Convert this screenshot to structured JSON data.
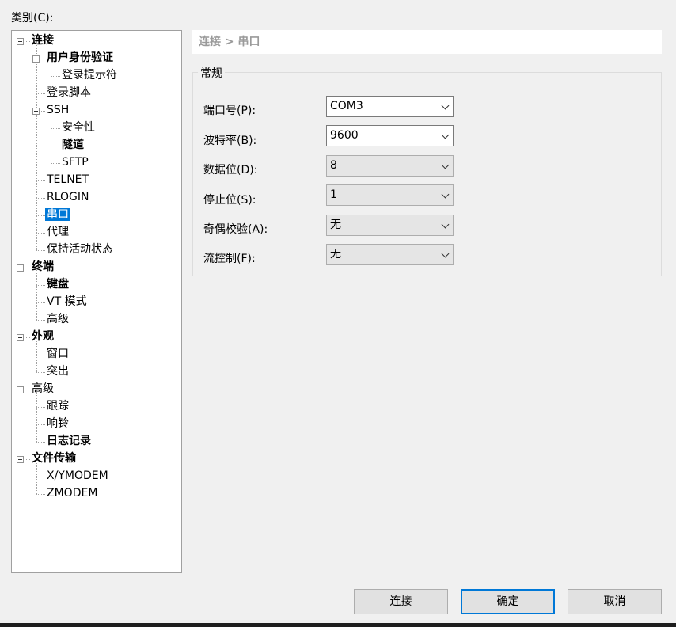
{
  "category_label": "类别(C):",
  "tree": [
    {
      "label": "连接",
      "level": 0,
      "bold": true,
      "toggle": true
    },
    {
      "label": "用户身份验证",
      "level": 1,
      "bold": true,
      "toggle": true
    },
    {
      "label": "登录提示符",
      "level": 2,
      "bold": false,
      "toggle": false
    },
    {
      "label": "登录脚本",
      "level": 1,
      "bold": false,
      "toggle": false
    },
    {
      "label": "SSH",
      "level": 1,
      "bold": false,
      "toggle": true
    },
    {
      "label": "安全性",
      "level": 2,
      "bold": false,
      "toggle": false
    },
    {
      "label": "隧道",
      "level": 2,
      "bold": true,
      "toggle": false
    },
    {
      "label": "SFTP",
      "level": 2,
      "bold": false,
      "toggle": false
    },
    {
      "label": "TELNET",
      "level": 1,
      "bold": false,
      "toggle": false
    },
    {
      "label": "RLOGIN",
      "level": 1,
      "bold": false,
      "toggle": false
    },
    {
      "label": "串口",
      "level": 1,
      "bold": false,
      "toggle": false,
      "selected": true
    },
    {
      "label": "代理",
      "level": 1,
      "bold": false,
      "toggle": false
    },
    {
      "label": "保持活动状态",
      "level": 1,
      "bold": false,
      "toggle": false
    },
    {
      "label": "终端",
      "level": 0,
      "bold": true,
      "toggle": true
    },
    {
      "label": "键盘",
      "level": 1,
      "bold": true,
      "toggle": false
    },
    {
      "label": "VT 模式",
      "level": 1,
      "bold": false,
      "toggle": false
    },
    {
      "label": "高级",
      "level": 1,
      "bold": false,
      "toggle": false
    },
    {
      "label": "外观",
      "level": 0,
      "bold": true,
      "toggle": true
    },
    {
      "label": "窗口",
      "level": 1,
      "bold": false,
      "toggle": false
    },
    {
      "label": "突出",
      "level": 1,
      "bold": false,
      "toggle": false
    },
    {
      "label": "高级",
      "level": 0,
      "bold": false,
      "toggle": true
    },
    {
      "label": "跟踪",
      "level": 1,
      "bold": false,
      "toggle": false
    },
    {
      "label": "响铃",
      "level": 1,
      "bold": false,
      "toggle": false
    },
    {
      "label": "日志记录",
      "level": 1,
      "bold": true,
      "toggle": false
    },
    {
      "label": "文件传输",
      "level": 0,
      "bold": true,
      "toggle": true
    },
    {
      "label": "X/YMODEM",
      "level": 1,
      "bold": false,
      "toggle": false
    },
    {
      "label": "ZMODEM",
      "level": 1,
      "bold": false,
      "toggle": false
    }
  ],
  "breadcrumb": "连接 > 串口",
  "group_title": "常规",
  "fields": {
    "port": {
      "label": "端口号(P):",
      "value": "COM3"
    },
    "baud": {
      "label": "波特率(B):",
      "value": "9600"
    },
    "databits": {
      "label": "数据位(D):",
      "value": "8"
    },
    "stopbits": {
      "label": "停止位(S):",
      "value": "1"
    },
    "parity": {
      "label": "奇偶校验(A):",
      "value": "无"
    },
    "flow": {
      "label": "流控制(F):",
      "value": "无"
    }
  },
  "buttons": {
    "connect": "连接",
    "ok": "确定",
    "cancel": "取消"
  },
  "colors": {
    "selection": "#0078d7",
    "default_button_border": "#0078d7"
  }
}
